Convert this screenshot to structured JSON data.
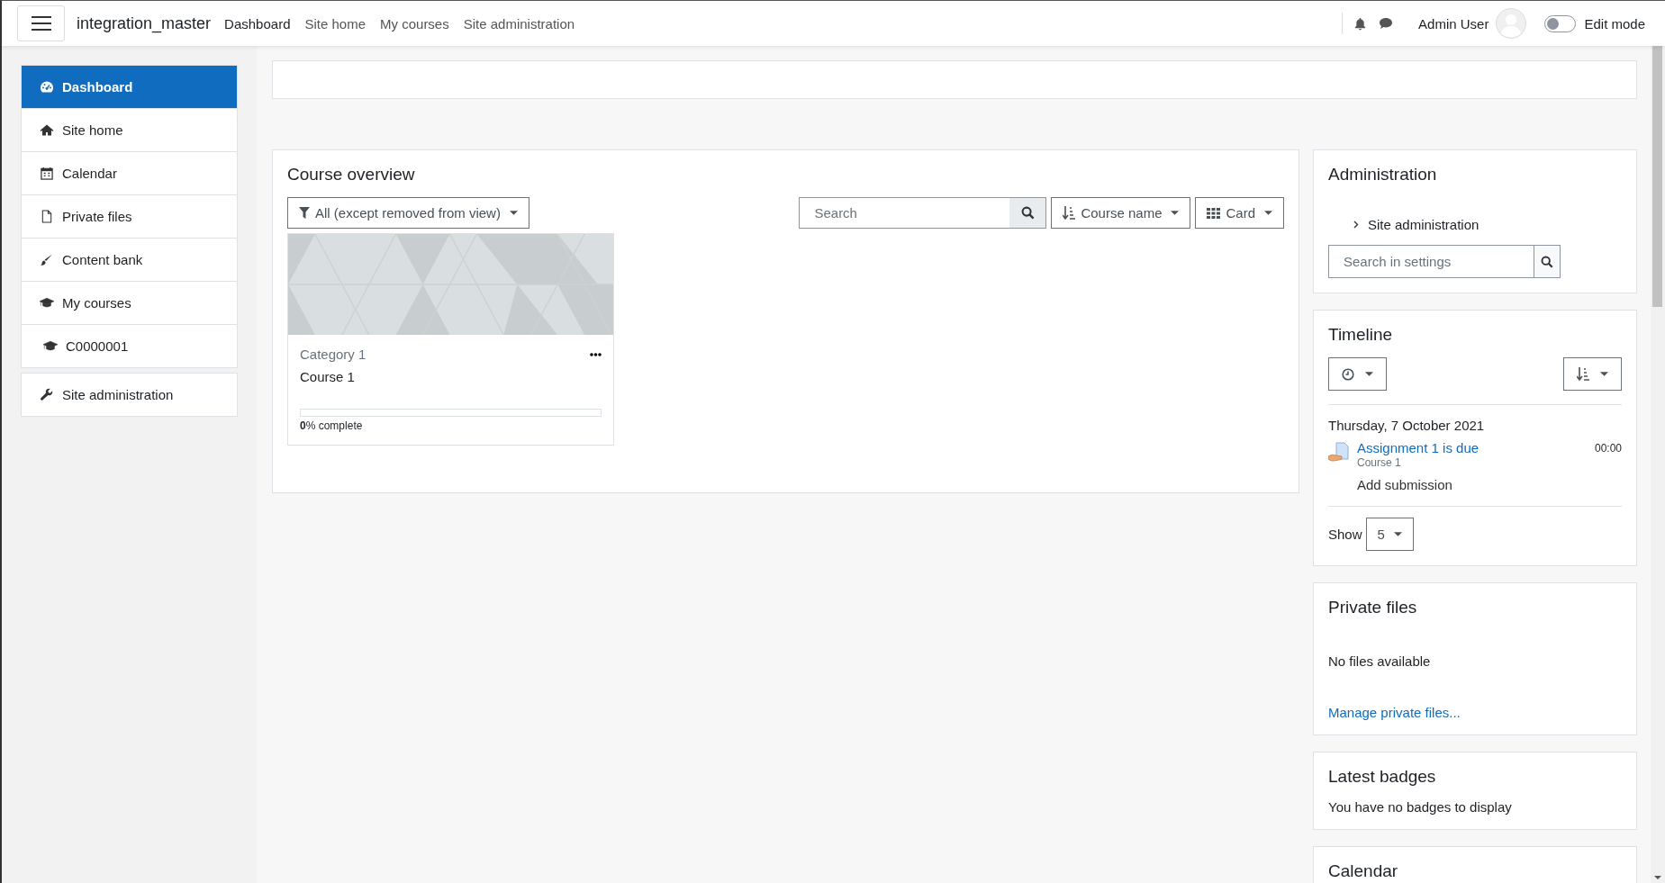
{
  "navbar": {
    "site_name": "integration_master",
    "links": [
      {
        "label": "Dashboard",
        "selected": true
      },
      {
        "label": "Site home",
        "selected": false
      },
      {
        "label": "My courses",
        "selected": false
      },
      {
        "label": "Site administration",
        "selected": false
      }
    ],
    "user_name": "Admin User",
    "edit_mode": {
      "label": "Edit mode",
      "on": false
    }
  },
  "sidebar": {
    "items": [
      {
        "label": "Dashboard",
        "selected": true
      },
      {
        "label": "Site home",
        "selected": false
      },
      {
        "label": "Calendar",
        "selected": false
      },
      {
        "label": "Private files",
        "selected": false
      },
      {
        "label": "Content bank",
        "selected": false
      },
      {
        "label": "My courses",
        "selected": false,
        "children": [
          {
            "label": "C0000001",
            "selected": false
          }
        ]
      }
    ],
    "admin_item": {
      "label": "Site administration",
      "selected": false
    }
  },
  "course_overview": {
    "title": "Course overview",
    "filter": "All (except removed from view)",
    "search_placeholder": "Search",
    "sort": "Course name",
    "view": "Card",
    "courses": [
      {
        "category": "Category 1",
        "name": "Course 1",
        "progress_text": "**0**% complete",
        "level": 0
      }
    ]
  },
  "administration": {
    "title": "Administration",
    "items": [
      {
        "label": "Site administration",
        "expanded": false
      }
    ],
    "search_placeholder": "Search in settings"
  },
  "timeline": {
    "title": "Timeline",
    "date": "Thursday, 7 October 2021",
    "events": [
      {
        "name": "Assignment 1 is due",
        "course": "Course 1",
        "time": "00:00",
        "action": "Add submission"
      }
    ],
    "show_label": "Show",
    "per_page": "5"
  },
  "private_files": {
    "title": "Private files",
    "message": "No files available",
    "link": "Manage private files..."
  },
  "latest_badges": {
    "title": "Latest badges",
    "message": "You have no badges to display"
  },
  "calendar": {
    "title": "Calendar"
  }
}
